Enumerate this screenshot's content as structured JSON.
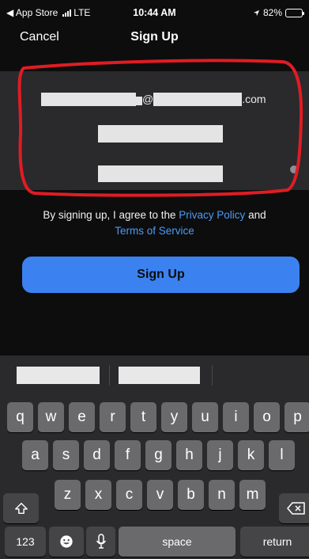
{
  "status": {
    "back_app": "◀ App Store",
    "network": "LTE",
    "time": "10:44 AM",
    "battery": "82%",
    "battery_fraction": 0.82
  },
  "nav": {
    "cancel": "Cancel",
    "title": "Sign Up"
  },
  "form": {
    "email_at": "@",
    "email_suffix": ".com"
  },
  "agreement": {
    "prefix": "By signing up, I agree to the ",
    "privacy_link": "Privacy Policy",
    "and": " and",
    "terms_link": "Terms of Service"
  },
  "signup_button": "Sign Up",
  "keyboard": {
    "row1": [
      "q",
      "w",
      "e",
      "r",
      "t",
      "y",
      "u",
      "i",
      "o",
      "p"
    ],
    "row2": [
      "a",
      "s",
      "d",
      "f",
      "g",
      "h",
      "j",
      "k",
      "l"
    ],
    "row3": [
      "z",
      "x",
      "c",
      "v",
      "b",
      "n",
      "m"
    ],
    "numbers_key": "123",
    "space_key": "space",
    "return_key": "return"
  },
  "icons": [
    "location-arrow-icon",
    "signal-icon",
    "battery-icon",
    "shift-icon",
    "delete-icon",
    "emoji-icon",
    "microphone-icon"
  ],
  "colors": {
    "accent": "#3b82f0",
    "link": "#4b9bf5",
    "annotation": "#e01c24"
  }
}
